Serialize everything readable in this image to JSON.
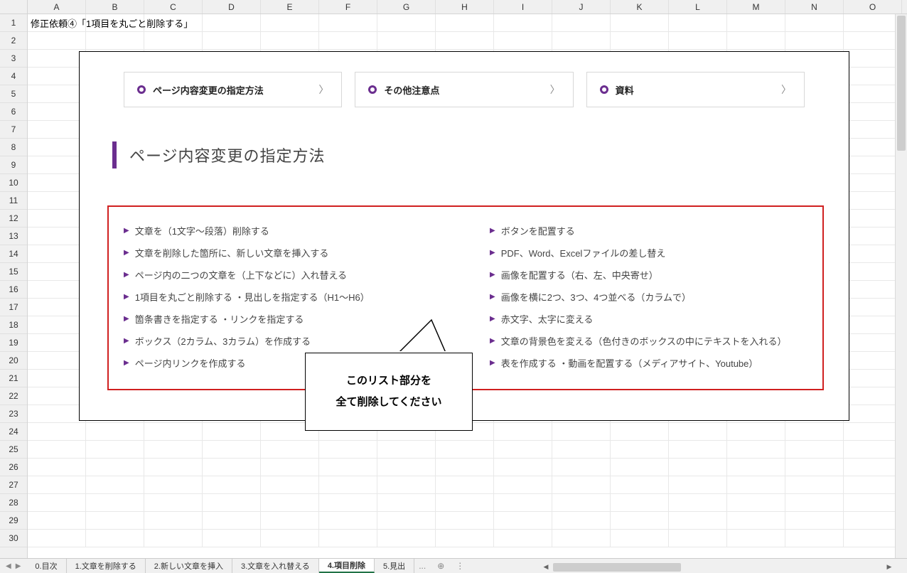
{
  "columns": [
    "A",
    "B",
    "C",
    "D",
    "E",
    "F",
    "G",
    "H",
    "I",
    "J",
    "K",
    "L",
    "M",
    "N",
    "O"
  ],
  "row_count": 30,
  "cell_a1": "修正依頼④「1項目を丸ごと削除する」",
  "nav_cards": [
    {
      "label": "ページ内容変更の指定方法"
    },
    {
      "label": "その他注意点"
    },
    {
      "label": "資料"
    }
  ],
  "section_heading": "ページ内容変更の指定方法",
  "list_left": [
    "文章を（1文字～段落）削除する",
    "文章を削除した箇所に、新しい文章を挿入する",
    "ページ内の二つの文章を（上下などに）入れ替える",
    "1項目を丸ごと削除する ・見出しを指定する（H1～H6）",
    "箇条書きを指定する ・リンクを指定する",
    "ボックス（2カラム、3カラム）を作成する",
    "ページ内リンクを作成する"
  ],
  "list_right": [
    "ボタンを配置する",
    "PDF、Word、Excelファイルの差し替え",
    "画像を配置する（右、左、中央寄せ）",
    "画像を横に2つ、3つ、4つ並べる（カラムで）",
    "赤文字、太字に変える",
    "文章の背景色を変える（色付きのボックスの中にテキストを入れる）",
    "表を作成する ・動画を配置する（メディアサイト、Youtube）"
  ],
  "callout_line1": "このリスト部分を",
  "callout_line2": "全て削除してください",
  "tabs": [
    {
      "label": "0.目次",
      "active": false
    },
    {
      "label": "1.文章を削除する",
      "active": false
    },
    {
      "label": "2.新しい文章を挿入",
      "active": false
    },
    {
      "label": "3.文章を入れ替える",
      "active": false
    },
    {
      "label": "4.項目削除",
      "active": true
    },
    {
      "label": "5.見出",
      "active": false
    }
  ],
  "tab_ellipsis": "..."
}
